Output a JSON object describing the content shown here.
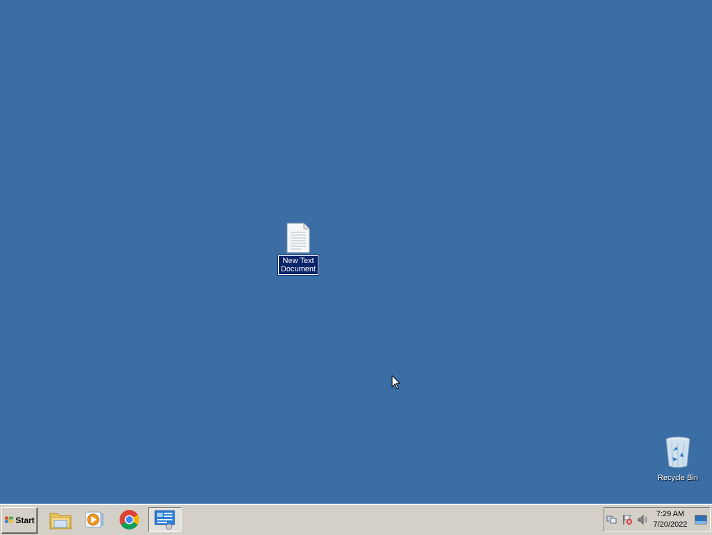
{
  "desktop": {
    "background_color": "#3a6ea5",
    "icons": [
      {
        "label": "New Text Document",
        "label_line1": "New Text",
        "label_line2": "Document",
        "icon": "text-document-icon",
        "selected": true
      },
      {
        "label": "Recycle Bin",
        "icon": "recycle-bin-icon",
        "selected": false
      }
    ]
  },
  "taskbar": {
    "start_label": "Start",
    "quick_launch": [
      {
        "icon": "file-explorer-icon",
        "active": false
      },
      {
        "icon": "media-player-icon",
        "active": false
      },
      {
        "icon": "chrome-icon",
        "active": false
      },
      {
        "icon": "control-panel-icon",
        "active": true
      }
    ],
    "tray": {
      "icons": [
        "network-icon",
        "action-center-icon",
        "volume-icon",
        "show-desktop-icon"
      ],
      "time": "7:29 AM",
      "date": "7/20/2022"
    }
  }
}
